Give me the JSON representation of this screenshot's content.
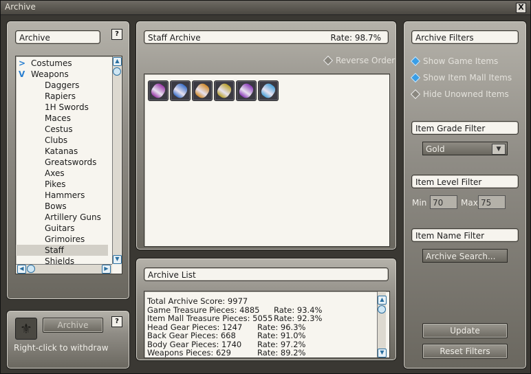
{
  "window": {
    "title": "Archive",
    "close_label": "X"
  },
  "left_panel": {
    "header": "Archive",
    "help_label": "?",
    "tree": [
      {
        "label": "Costumes",
        "type": "cat",
        "icon": ">"
      },
      {
        "label": "Weapons",
        "type": "cat",
        "icon": "V"
      },
      {
        "label": "Daggers",
        "type": "sub"
      },
      {
        "label": "Rapiers",
        "type": "sub"
      },
      {
        "label": "1H Swords",
        "type": "sub"
      },
      {
        "label": "Maces",
        "type": "sub"
      },
      {
        "label": "Cestus",
        "type": "sub"
      },
      {
        "label": "Clubs",
        "type": "sub"
      },
      {
        "label": "Katanas",
        "type": "sub"
      },
      {
        "label": "Greatswords",
        "type": "sub"
      },
      {
        "label": "Axes",
        "type": "sub"
      },
      {
        "label": "Pikes",
        "type": "sub"
      },
      {
        "label": "Hammers",
        "type": "sub"
      },
      {
        "label": "Bows",
        "type": "sub"
      },
      {
        "label": "Artillery Guns",
        "type": "sub"
      },
      {
        "label": "Guitars",
        "type": "sub"
      },
      {
        "label": "Grimoires",
        "type": "sub"
      },
      {
        "label": "Staff",
        "type": "sub",
        "selected": true
      },
      {
        "label": "Shields",
        "type": "sub"
      }
    ]
  },
  "withdraw_panel": {
    "button": "Archive",
    "help_label": "?",
    "hint": "Right-click to withdraw"
  },
  "staff_panel": {
    "header": "Staff Archive",
    "rate": "Rate: 98.7%",
    "reverse_order": "Reverse Order",
    "slot_colors": [
      "#9a3aa8",
      "#3a6ec8",
      "#d08a2a",
      "#b8a02a",
      "#8a3ab8",
      "#4aa0d8"
    ]
  },
  "archive_list": {
    "header": "Archive List",
    "lines": [
      {
        "a": "Total Archive Score: 9977",
        "b": ""
      },
      {
        "a": "Game Treasure Pieces: 4885",
        "b": "Rate: 93.4%"
      },
      {
        "a": "Item Mall Treasure Pieces: 5055",
        "b": "Rate: 92.3%"
      },
      {
        "a": "Head Gear  Pieces: 1247",
        "b": "Rate: 96.3%"
      },
      {
        "a": "Back Gear   Pieces: 668",
        "b": "Rate: 91.0%"
      },
      {
        "a": "Body Gear  Pieces: 1740",
        "b": "Rate: 97.2%"
      },
      {
        "a": "Weapons   Pieces: 629",
        "b": "Rate: 89.2%"
      }
    ]
  },
  "filters": {
    "header": "Archive Filters",
    "options": [
      {
        "label": "Show Game Items",
        "on": true
      },
      {
        "label": "Show Item Mall Items",
        "on": true
      },
      {
        "label": "Hide Unowned Items",
        "on": false
      }
    ],
    "grade_header": "Item Grade Filter",
    "grade_value": "Gold",
    "level_header": "Item Level Filter",
    "min_label": "Min",
    "min_value": "70",
    "max_label": "Max",
    "max_value": "75",
    "name_header": "Item Name Filter",
    "search_placeholder": "Archive Search...",
    "update": "Update",
    "reset": "Reset Filters"
  }
}
